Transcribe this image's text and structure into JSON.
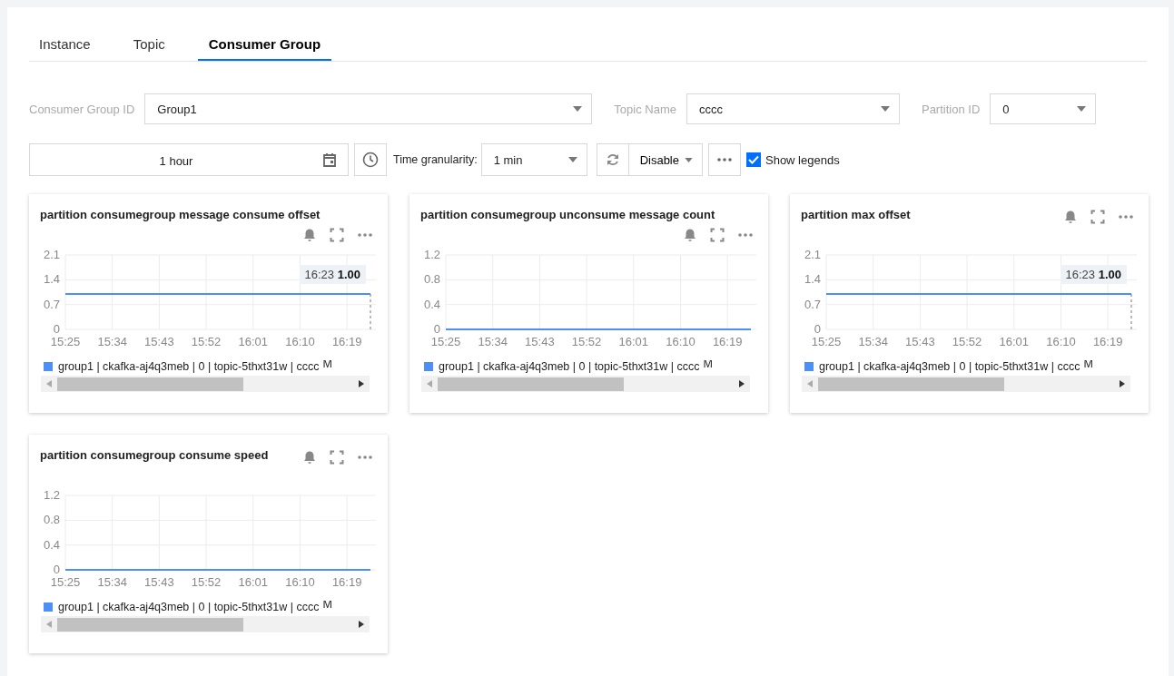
{
  "tabs": [
    {
      "label": "Instance",
      "selected": false
    },
    {
      "label": "Topic",
      "selected": false
    },
    {
      "label": "Consumer Group",
      "selected": true
    }
  ],
  "filters": [
    {
      "label": "Consumer Group ID",
      "value": "Group1"
    },
    {
      "label": "Topic Name",
      "value": "cccc"
    },
    {
      "label": "Partition ID",
      "value": "0"
    }
  ],
  "time_range": {
    "value": "1 hour"
  },
  "granularity": {
    "label": "Time granularity:",
    "value": "1 min"
  },
  "auto_refresh": {
    "value": "Disable"
  },
  "show_legends": {
    "label": "Show legends",
    "checked": true
  },
  "charts": [
    {
      "title": "partition consumegroup message consume offset",
      "tooltip": {
        "time": "16:23",
        "value": "1.00"
      },
      "legend_more": "M",
      "chart_data": {
        "type": "line",
        "grid": true,
        "categories": [
          "15:25",
          null,
          "15:34",
          null,
          "15:43",
          null,
          "15:52",
          null,
          "16:01",
          null,
          "16:10",
          null,
          "16:19",
          null
        ],
        "ylim": [
          0,
          2.1
        ],
        "yticks": [
          {
            "value": 0,
            "label": "0"
          },
          {
            "value": 0.7,
            "label": "0.7"
          },
          {
            "value": 1.4,
            "label": "1.4"
          },
          {
            "value": 2.1,
            "label": "2.1"
          }
        ],
        "series": [
          {
            "name": "group1 | ckafka-aj4q3meb | 0 | topic-5thxt31w | cccc",
            "color": "#4e8ff7",
            "values": [
              1,
              1,
              1,
              1,
              1,
              1,
              1,
              1,
              1,
              1,
              1,
              1,
              1,
              1
            ]
          }
        ]
      }
    },
    {
      "title": "partition consumegroup unconsume message count",
      "legend_more": "M",
      "chart_data": {
        "type": "line",
        "grid": true,
        "categories": [
          "15:25",
          null,
          "15:34",
          null,
          "15:43",
          null,
          "15:52",
          null,
          "16:01",
          null,
          "16:10",
          null,
          "16:19",
          null
        ],
        "ylim": [
          0,
          1.2
        ],
        "yticks": [
          {
            "value": 0,
            "label": "0"
          },
          {
            "value": 0.4,
            "label": "0.4"
          },
          {
            "value": 0.8,
            "label": "0.8"
          },
          {
            "value": 1.2,
            "label": "1.2"
          }
        ],
        "series": [
          {
            "name": "group1 | ckafka-aj4q3meb | 0 | topic-5thxt31w | cccc",
            "color": "#4e8ff7",
            "values": [
              0,
              0,
              0,
              0,
              0,
              0,
              0,
              0,
              0,
              0,
              0,
              0,
              0,
              0
            ]
          }
        ]
      }
    },
    {
      "title": "partition max offset",
      "tooltip": {
        "time": "16:23",
        "value": "1.00"
      },
      "legend_more": "M",
      "chart_data": {
        "type": "line",
        "grid": true,
        "categories": [
          "15:25",
          null,
          "15:34",
          null,
          "15:43",
          null,
          "15:52",
          null,
          "16:01",
          null,
          "16:10",
          null,
          "16:19",
          null
        ],
        "ylim": [
          0,
          2.1
        ],
        "yticks": [
          {
            "value": 0,
            "label": "0"
          },
          {
            "value": 0.7,
            "label": "0.7"
          },
          {
            "value": 1.4,
            "label": "1.4"
          },
          {
            "value": 2.1,
            "label": "2.1"
          }
        ],
        "series": [
          {
            "name": "group1 | ckafka-aj4q3meb | 0 | topic-5thxt31w | cccc",
            "color": "#4e8ff7",
            "values": [
              1,
              1,
              1,
              1,
              1,
              1,
              1,
              1,
              1,
              1,
              1,
              1,
              1,
              1
            ]
          }
        ]
      }
    },
    {
      "title": "partition consumegroup consume speed",
      "legend_more": "M",
      "chart_data": {
        "type": "line",
        "grid": true,
        "categories": [
          "15:25",
          null,
          "15:34",
          null,
          "15:43",
          null,
          "15:52",
          null,
          "16:01",
          null,
          "16:10",
          null,
          "16:19",
          null
        ],
        "ylim": [
          0,
          1.2
        ],
        "yticks": [
          {
            "value": 0,
            "label": "0"
          },
          {
            "value": 0.4,
            "label": "0.4"
          },
          {
            "value": 0.8,
            "label": "0.8"
          },
          {
            "value": 1.2,
            "label": "1.2"
          }
        ],
        "series": [
          {
            "name": "group1 | ckafka-aj4q3meb | 0 | topic-5thxt31w | cccc",
            "color": "#4e8ff7",
            "values": [
              0,
              0,
              0,
              0,
              0,
              0,
              0,
              0,
              0,
              0,
              0,
              0,
              0,
              0
            ]
          }
        ]
      }
    }
  ]
}
